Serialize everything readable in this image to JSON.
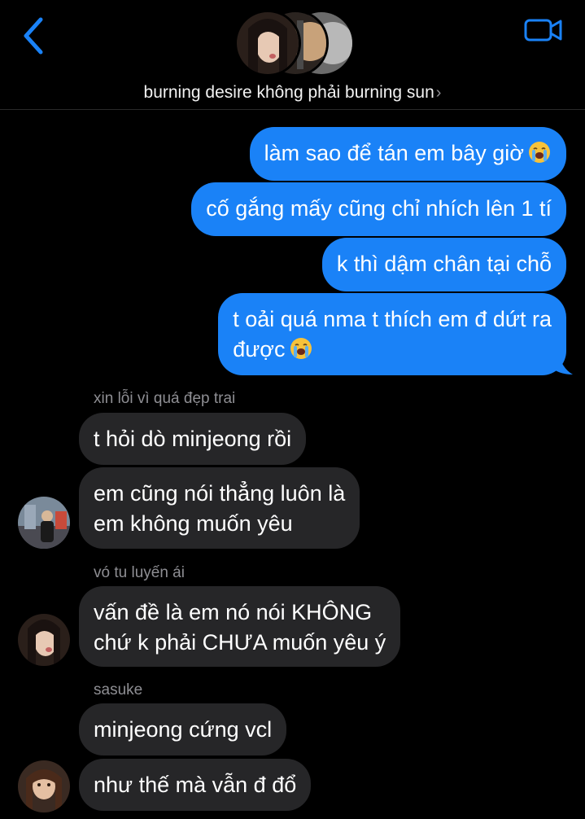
{
  "header": {
    "title": "burning desire không phải burning sun",
    "back_icon": "chevron-left-icon",
    "video_icon": "video-camera-icon",
    "accent_color": "#1a82f7"
  },
  "messages": {
    "outgoing": [
      {
        "text": "làm sao để tán em bây giờ",
        "emoji": "loudly-crying-face-icon"
      },
      {
        "text": "cố gắng mấy cũng chỉ nhích lên 1 tí"
      },
      {
        "text": "k thì dậm chân tại chỗ"
      },
      {
        "line1": "t oải quá nma t thích em đ dứt ra",
        "line2": "được",
        "emoji": "loudly-crying-face-icon"
      }
    ],
    "group1": {
      "sender": "xin lỗi vì quá đẹp trai",
      "bubble1": "t hỏi dò minjeong rồi",
      "bubble2_line1": "em cũng nói thẳng luôn là",
      "bubble2_line2": "em không muốn yêu"
    },
    "group2": {
      "sender": "vó tu luyến ái",
      "bubble1_line1": "vấn đề là em nó nói KHÔNG",
      "bubble1_line2": "chứ k phải CHƯA muốn yêu ý"
    },
    "group3": {
      "sender": "sasuke",
      "bubble1": "minjeong cứng vcl",
      "bubble2": "như thế mà vẫn đ đổ"
    }
  },
  "colors": {
    "outgoing_bubble": "#1a82f7",
    "incoming_bubble": "#262628",
    "sender_name": "#8e8e93",
    "background": "#000000"
  }
}
